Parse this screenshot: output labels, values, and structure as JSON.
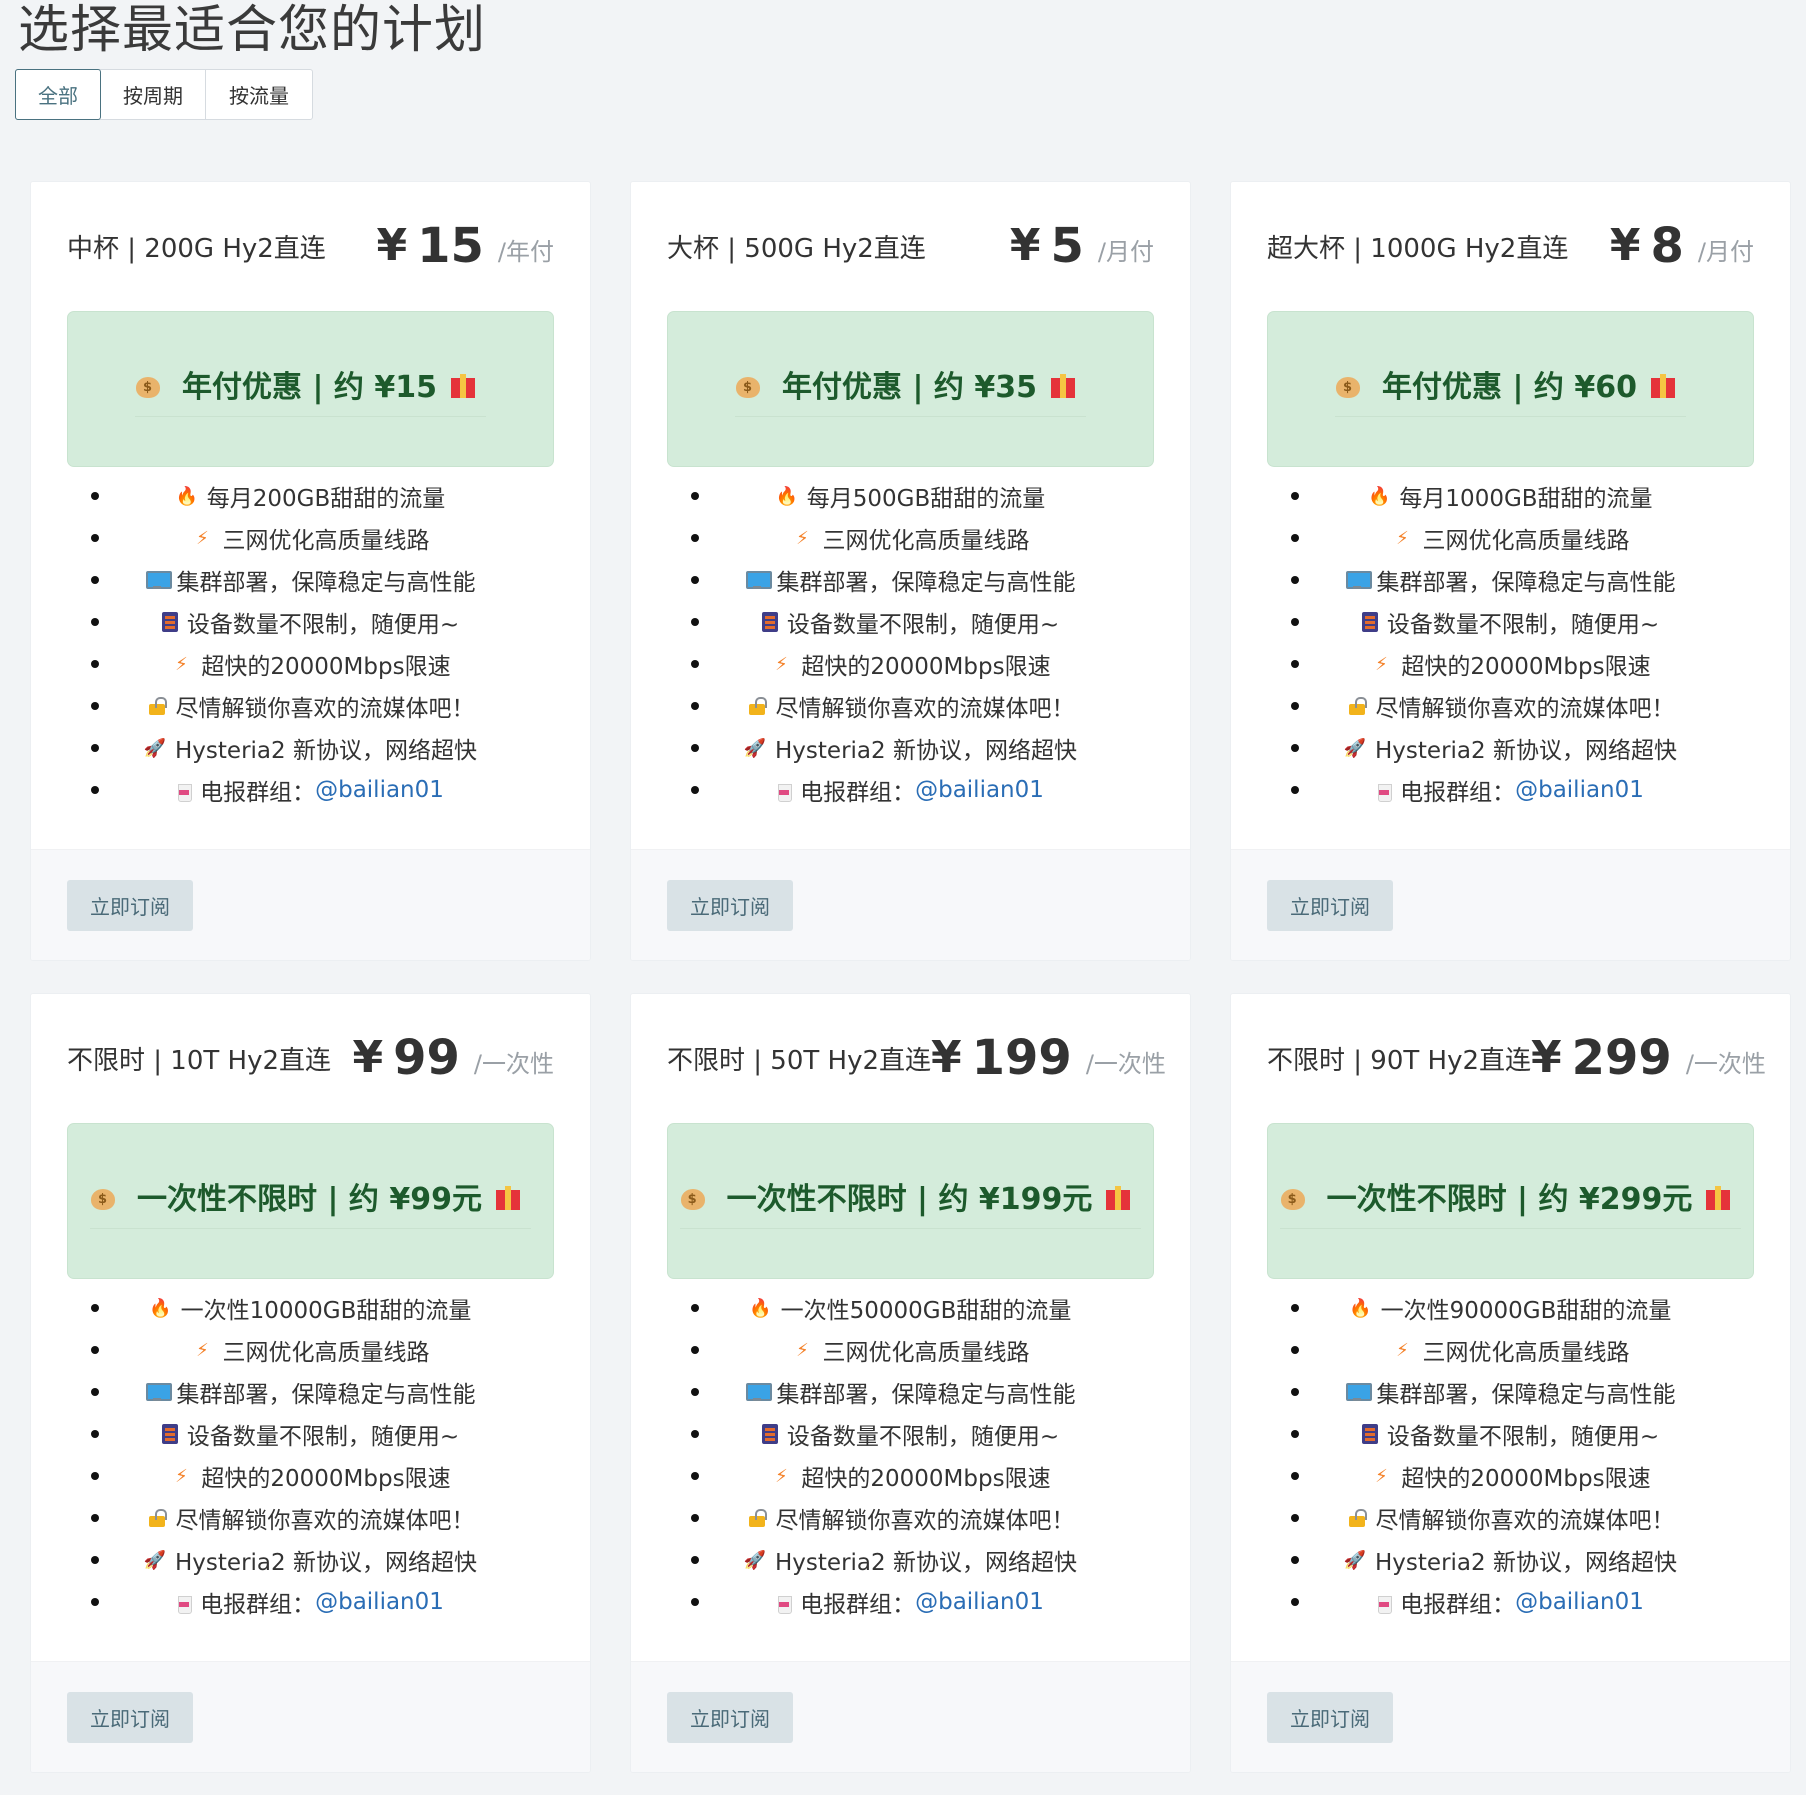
{
  "page": {
    "title": "选择最适合您的计划"
  },
  "tabs": [
    {
      "label": "全部",
      "active": true
    },
    {
      "label": "按周期",
      "active": false
    },
    {
      "label": "按流量",
      "active": false
    }
  ],
  "colors": {
    "promo_bg": "#d4ecdb",
    "promo_text": "#1d5a2c",
    "link": "#2a6db5",
    "button_bg": "#d9e2e6"
  },
  "subscribe_label": "立即订阅",
  "plans": [
    {
      "name": "中杯 | 200G Hy2直连",
      "currency": "¥",
      "price": "15",
      "unit": "/年付",
      "promo": "年付优惠 | 约 ¥15",
      "features": [
        {
          "icon": "fire-icon",
          "text": "每月200GB甜甜的流量"
        },
        {
          "icon": "lightning-icon",
          "text": "三网优化高质量线路"
        },
        {
          "icon": "monitor-icon",
          "text": "集群部署，保障稳定与高性能"
        },
        {
          "icon": "device-icon",
          "text": "设备数量不限制，随便用~"
        },
        {
          "icon": "lightning-icon",
          "text": "超快的20000Mbps限速"
        },
        {
          "icon": "unlock-icon",
          "text": "尽情解锁你喜欢的流媒体吧！"
        },
        {
          "icon": "rocket-icon",
          "text": "Hysteria2 新协议，网络超快"
        },
        {
          "icon": "drink-icon",
          "text": "电报群组：",
          "link": "@bailian01"
        }
      ]
    },
    {
      "name": "大杯 | 500G Hy2直连",
      "currency": "¥",
      "price": "5",
      "unit": "/月付",
      "promo": "年付优惠 | 约 ¥35",
      "features": [
        {
          "icon": "fire-icon",
          "text": "每月500GB甜甜的流量"
        },
        {
          "icon": "lightning-icon",
          "text": "三网优化高质量线路"
        },
        {
          "icon": "monitor-icon",
          "text": "集群部署，保障稳定与高性能"
        },
        {
          "icon": "device-icon",
          "text": "设备数量不限制，随便用~"
        },
        {
          "icon": "lightning-icon",
          "text": "超快的20000Mbps限速"
        },
        {
          "icon": "unlock-icon",
          "text": "尽情解锁你喜欢的流媒体吧！"
        },
        {
          "icon": "rocket-icon",
          "text": "Hysteria2 新协议，网络超快"
        },
        {
          "icon": "drink-icon",
          "text": "电报群组：",
          "link": "@bailian01"
        }
      ]
    },
    {
      "name": "超大杯 | 1000G Hy2直连",
      "currency": "¥",
      "price": "8",
      "unit": "/月付",
      "promo": "年付优惠 | 约 ¥60",
      "features": [
        {
          "icon": "fire-icon",
          "text": "每月1000GB甜甜的流量"
        },
        {
          "icon": "lightning-icon",
          "text": "三网优化高质量线路"
        },
        {
          "icon": "monitor-icon",
          "text": "集群部署，保障稳定与高性能"
        },
        {
          "icon": "device-icon",
          "text": "设备数量不限制，随便用~"
        },
        {
          "icon": "lightning-icon",
          "text": "超快的20000Mbps限速"
        },
        {
          "icon": "unlock-icon",
          "text": "尽情解锁你喜欢的流媒体吧！"
        },
        {
          "icon": "rocket-icon",
          "text": "Hysteria2 新协议，网络超快"
        },
        {
          "icon": "drink-icon",
          "text": "电报群组：",
          "link": "@bailian01"
        }
      ]
    },
    {
      "name": "不限时 | 10T Hy2直连",
      "currency": "¥",
      "price": "99",
      "unit": "/一次性",
      "promo": "一次性不限时 | 约 ¥99元",
      "features": [
        {
          "icon": "fire-icon",
          "text": "一次性10000GB甜甜的流量"
        },
        {
          "icon": "lightning-icon",
          "text": "三网优化高质量线路"
        },
        {
          "icon": "monitor-icon",
          "text": "集群部署，保障稳定与高性能"
        },
        {
          "icon": "device-icon",
          "text": "设备数量不限制，随便用~"
        },
        {
          "icon": "lightning-icon",
          "text": "超快的20000Mbps限速"
        },
        {
          "icon": "unlock-icon",
          "text": "尽情解锁你喜欢的流媒体吧！"
        },
        {
          "icon": "rocket-icon",
          "text": "Hysteria2 新协议，网络超快"
        },
        {
          "icon": "drink-icon",
          "text": "电报群组：",
          "link": "@bailian01"
        }
      ]
    },
    {
      "name": "不限时 | 50T Hy2直连",
      "currency": "¥",
      "price": "199",
      "unit": "/一次性",
      "promo": "一次性不限时 | 约 ¥199元",
      "features": [
        {
          "icon": "fire-icon",
          "text": "一次性50000GB甜甜的流量"
        },
        {
          "icon": "lightning-icon",
          "text": "三网优化高质量线路"
        },
        {
          "icon": "monitor-icon",
          "text": "集群部署，保障稳定与高性能"
        },
        {
          "icon": "device-icon",
          "text": "设备数量不限制，随便用~"
        },
        {
          "icon": "lightning-icon",
          "text": "超快的20000Mbps限速"
        },
        {
          "icon": "unlock-icon",
          "text": "尽情解锁你喜欢的流媒体吧！"
        },
        {
          "icon": "rocket-icon",
          "text": "Hysteria2 新协议，网络超快"
        },
        {
          "icon": "drink-icon",
          "text": "电报群组：",
          "link": "@bailian01"
        }
      ]
    },
    {
      "name": "不限时 | 90T Hy2直连",
      "currency": "¥",
      "price": "299",
      "unit": "/一次性",
      "promo": "一次性不限时 | 约 ¥299元",
      "features": [
        {
          "icon": "fire-icon",
          "text": "一次性90000GB甜甜的流量"
        },
        {
          "icon": "lightning-icon",
          "text": "三网优化高质量线路"
        },
        {
          "icon": "monitor-icon",
          "text": "集群部署，保障稳定与高性能"
        },
        {
          "icon": "device-icon",
          "text": "设备数量不限制，随便用~"
        },
        {
          "icon": "lightning-icon",
          "text": "超快的20000Mbps限速"
        },
        {
          "icon": "unlock-icon",
          "text": "尽情解锁你喜欢的流媒体吧！"
        },
        {
          "icon": "rocket-icon",
          "text": "Hysteria2 新协议，网络超快"
        },
        {
          "icon": "drink-icon",
          "text": "电报群组：",
          "link": "@bailian01"
        }
      ]
    }
  ]
}
